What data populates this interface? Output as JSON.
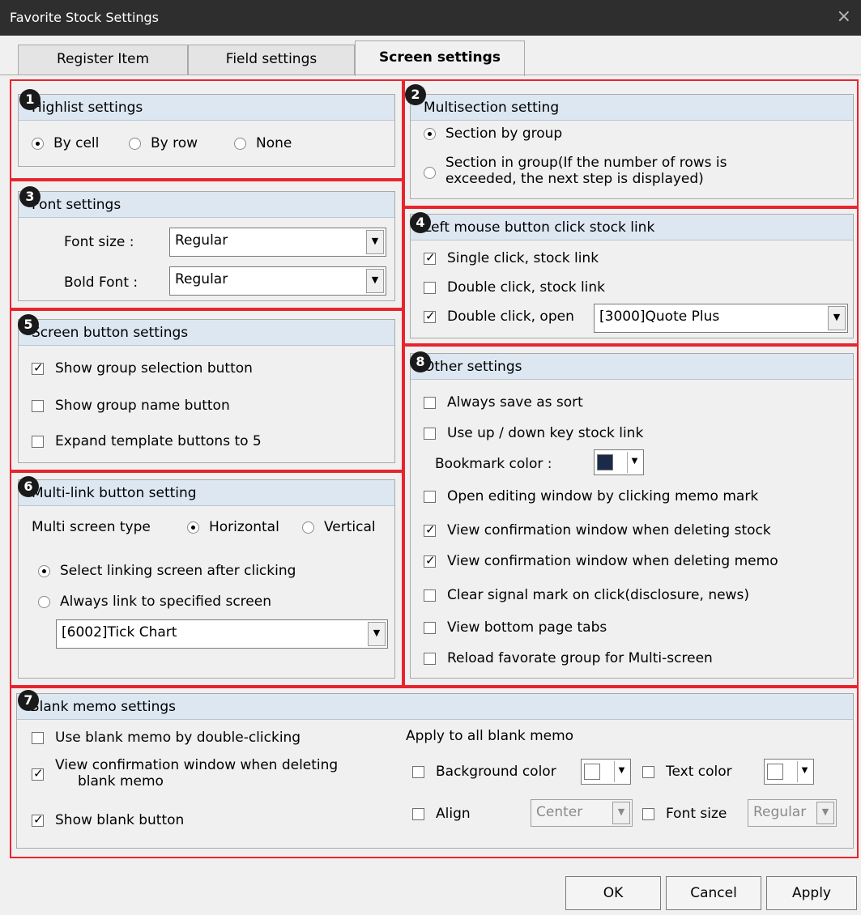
{
  "window": {
    "title": "Favorite Stock Settings",
    "close_glyph": "×"
  },
  "tabs": [
    {
      "label": "Register Item"
    },
    {
      "label": "Field settings"
    },
    {
      "label": "Screen settings"
    }
  ],
  "markers": [
    "1",
    "2",
    "3",
    "4",
    "5",
    "6",
    "7",
    "8"
  ],
  "highlist": {
    "title": "Highlist settings",
    "options": [
      {
        "label": "By cell",
        "selected": true
      },
      {
        "label": "By row",
        "selected": false
      },
      {
        "label": "None",
        "selected": false
      }
    ]
  },
  "multisection": {
    "title": "Multisection setting",
    "options": [
      {
        "label": "Section by group",
        "selected": true
      },
      {
        "label_line1": "Section in group(If the number of rows is",
        "label_line2": "exceeded, the next step is displayed)",
        "selected": false
      }
    ]
  },
  "font": {
    "title": "Font settings",
    "font_size_label": "Font size :",
    "font_size_value": "Regular",
    "bold_font_label": "Bold Font :",
    "bold_font_value": "Regular"
  },
  "left_mouse": {
    "title": "Left mouse button click stock link",
    "items": [
      {
        "label": "Single click, stock link",
        "checked": true
      },
      {
        "label": "Double click, stock link",
        "checked": false
      },
      {
        "label": "Double click, open",
        "checked": true
      }
    ],
    "open_select": "[3000]Quote Plus"
  },
  "screen_button": {
    "title": "Screen button settings",
    "items": [
      {
        "label": "Show group selection button",
        "checked": true
      },
      {
        "label": "Show group name button",
        "checked": false
      },
      {
        "label": "Expand template buttons to 5",
        "checked": false
      }
    ]
  },
  "multilink": {
    "title": "Multi-link button setting",
    "screen_type_label": "Multi screen type",
    "horizontal": "Horizontal",
    "vertical": "Vertical",
    "horizontal_selected": true,
    "select_after_click": "Select linking screen after clicking",
    "always_link": "Always link to specified screen",
    "select_after_click_selected": true,
    "screen_select": "[6002]Tick Chart"
  },
  "other": {
    "title": "Other settings",
    "items": [
      {
        "label": "Always save as sort",
        "checked": false
      },
      {
        "label": "Use up / down key stock link",
        "checked": false
      },
      {
        "label": "Open editing window by clicking memo mark",
        "checked": false
      },
      {
        "label": "View confirmation window when deleting stock",
        "checked": true
      },
      {
        "label": "View confirmation window when deleting memo",
        "checked": true
      },
      {
        "label": "Clear signal mark on click(disclosure, news)",
        "checked": false
      },
      {
        "label": "View bottom page tabs",
        "checked": false
      },
      {
        "label": "Reload favorate group for Multi-screen",
        "checked": false
      }
    ],
    "bookmark_label": "Bookmark color :",
    "bookmark_color": "#1c2a4a"
  },
  "blank_memo": {
    "title": "Blank memo settings",
    "use_double_click": "Use blank memo by double-clicking",
    "view_confirm_line1": "View confirmation window when deleting",
    "view_confirm_line2": "blank memo",
    "show_blank_button": "Show blank button",
    "apply_all": "Apply to all blank memo",
    "background_color": "Background color",
    "text_color": "Text color",
    "align": "Align",
    "align_value": "Center",
    "font_size": "Font size",
    "font_size_value": "Regular",
    "checked": {
      "use_double_click": false,
      "view_confirm": true,
      "show_blank_button": true
    }
  },
  "buttons": {
    "ok": "OK",
    "cancel": "Cancel",
    "apply": "Apply"
  },
  "colors": {
    "highlight": "#e8252e",
    "group_header": "#dde7f2",
    "title_bar": "#2e2e2e"
  }
}
